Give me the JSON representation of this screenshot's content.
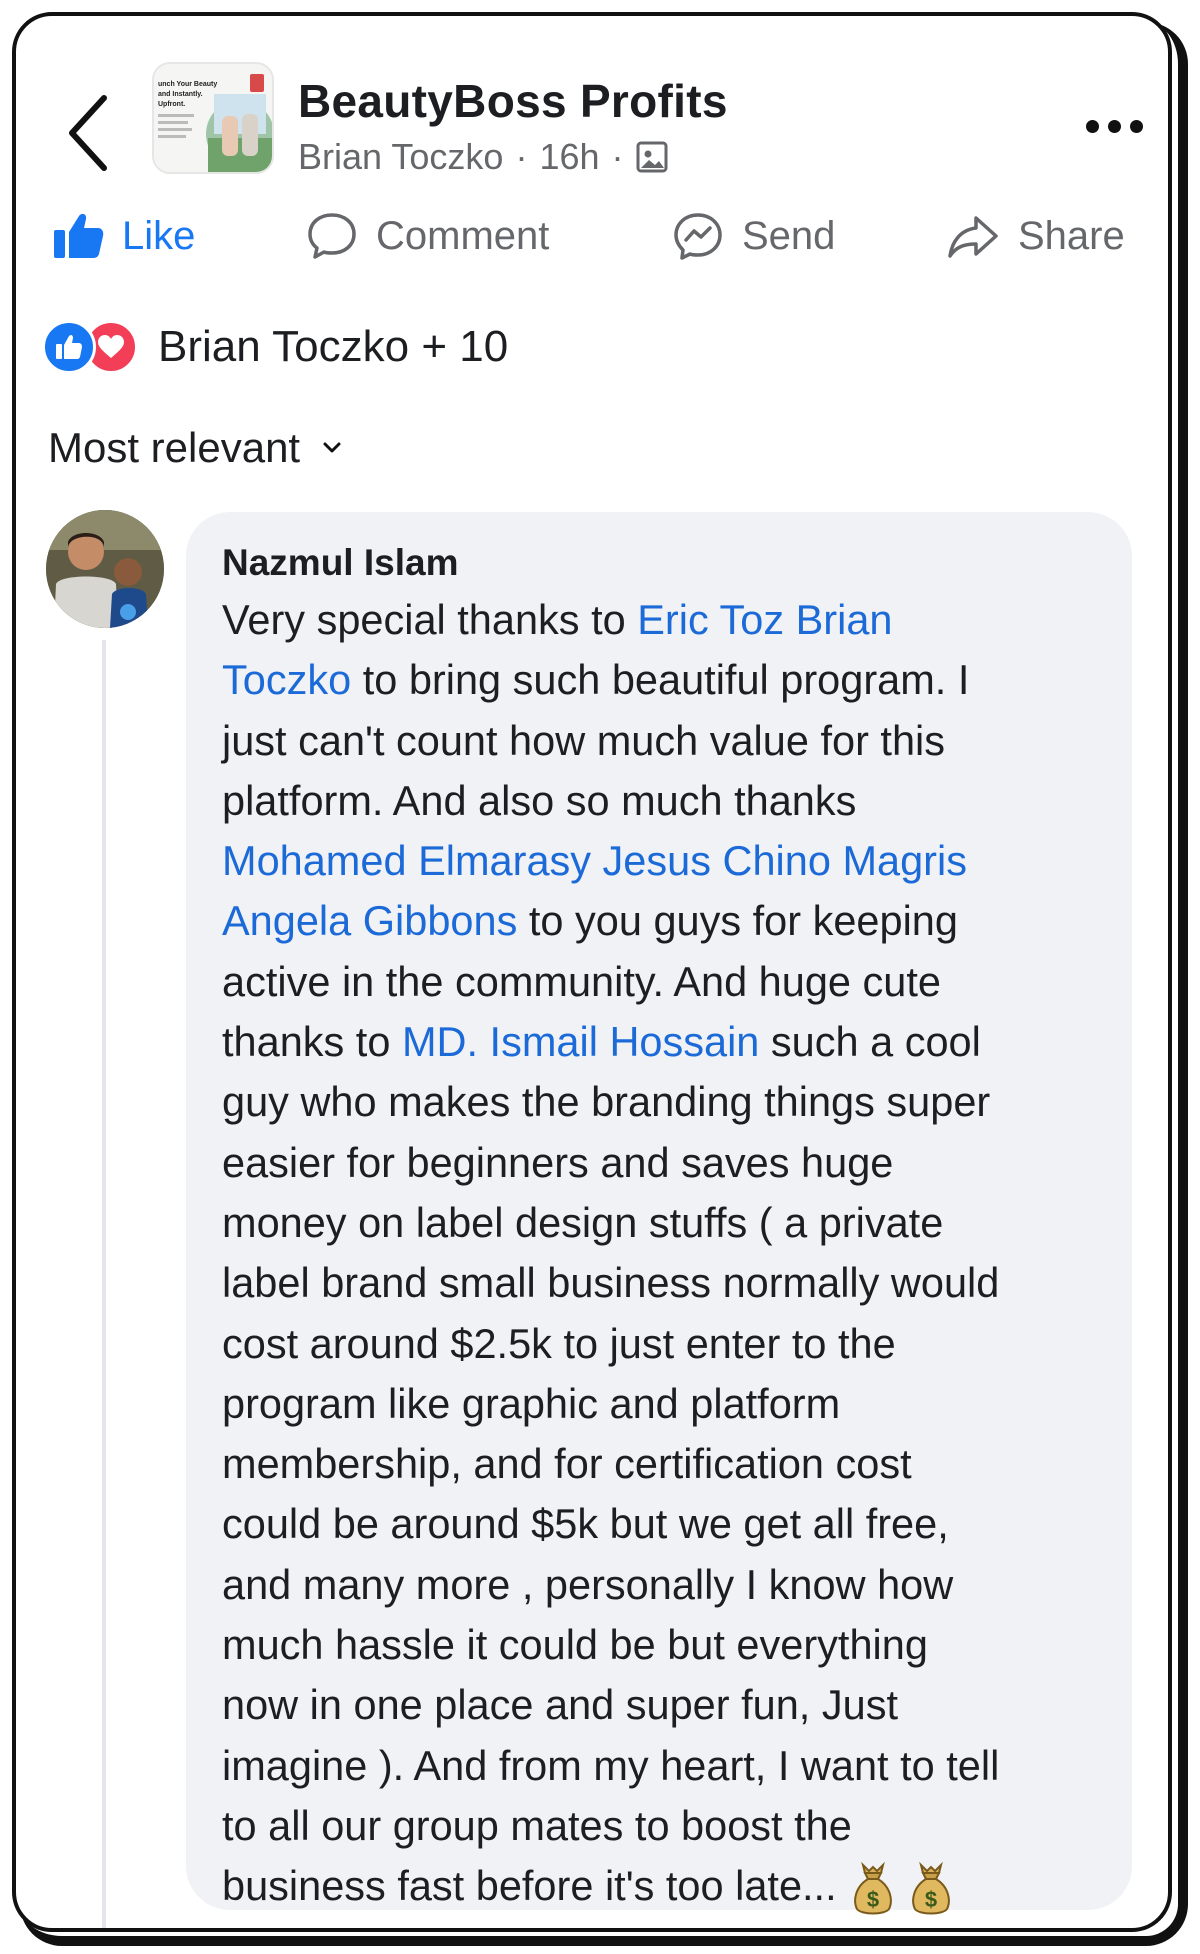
{
  "header": {
    "group_name": "BeautyBoss Profits",
    "author": "Brian Toczko",
    "separator": "·",
    "time": "16h",
    "thumbnail_text": [
      "unch Your Beauty",
      "and Instantly.",
      "Upfront."
    ]
  },
  "actions": {
    "like": "Like",
    "comment": "Comment",
    "send": "Send",
    "share": "Share"
  },
  "reactions": {
    "summary": "Brian Toczko + 10"
  },
  "sort": {
    "label": "Most relevant"
  },
  "comment": {
    "author": "Nazmul Islam",
    "lines": [
      [
        {
          "t": "Very special thanks to "
        },
        {
          "t": "Eric Toz Brian",
          "m": true
        }
      ],
      [
        {
          "t": "Toczko",
          "m": true
        },
        {
          "t": " to bring such beautiful program.   I"
        }
      ],
      [
        {
          "t": "just can't count how much value for this"
        }
      ],
      [
        {
          "t": "platform. And also so much thanks"
        }
      ],
      [
        {
          "t": "Mohamed Elmarasy Jesus Chino Magris",
          "m": true
        }
      ],
      [
        {
          "t": "Angela Gibbons",
          "m": true
        },
        {
          "t": " to you guys for keeping"
        }
      ],
      [
        {
          "t": "active in the community. And huge cute"
        }
      ],
      [
        {
          "t": "thanks to "
        },
        {
          "t": "MD. Ismail Hossain",
          "m": true
        },
        {
          "t": " such a cool"
        }
      ],
      [
        {
          "t": "guy who makes the branding things super"
        }
      ],
      [
        {
          "t": "easier for beginners and saves huge"
        }
      ],
      [
        {
          "t": "money on label design stuffs ( a private"
        }
      ],
      [
        {
          "t": "label brand small business normally would"
        }
      ],
      [
        {
          "t": "cost around $2.5k to just enter to the"
        }
      ],
      [
        {
          "t": "program like graphic and platform"
        }
      ],
      [
        {
          "t": "membership, and for certification cost"
        }
      ],
      [
        {
          "t": "could be around $5k but we get all free,"
        }
      ],
      [
        {
          "t": "and many more , personally I know how"
        }
      ],
      [
        {
          "t": "much hassle it could be but everything"
        }
      ],
      [
        {
          "t": "now in one place and super fun, Just"
        }
      ],
      [
        {
          "t": "imagine ). And from my heart, I want to tell"
        }
      ],
      [
        {
          "t": "to all our group mates to boost the"
        }
      ],
      [
        {
          "t": "business fast before it's too late..."
        },
        {
          "emoji": "money-bag"
        },
        {
          "emoji": "money-bag"
        }
      ]
    ]
  },
  "colors": {
    "link": "#1c6ad8",
    "like_blue": "#1877f2",
    "love_red": "#f33e58",
    "bubble_bg": "#f0f2f5",
    "secondary_text": "#65676b"
  },
  "icons": [
    "back-arrow-icon",
    "photo-icon",
    "more-dots-icon",
    "thumbs-up-icon",
    "comment-bubble-icon",
    "messenger-send-icon",
    "share-arrow-icon",
    "chevron-down-icon",
    "money-bag-icon"
  ]
}
